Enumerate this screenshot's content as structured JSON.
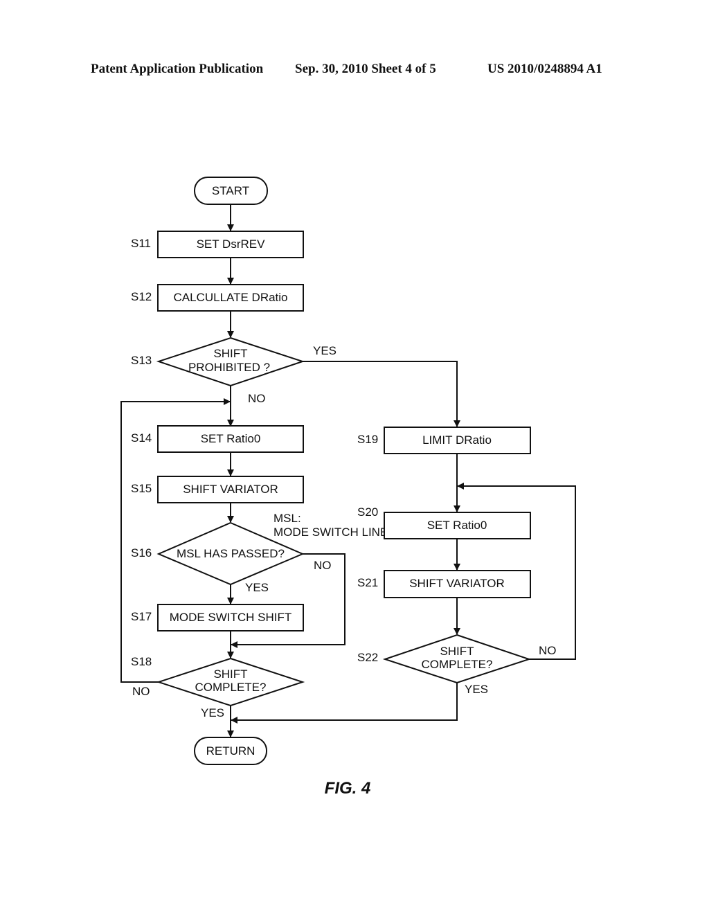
{
  "header": {
    "publication": "Patent Application Publication",
    "date_sheet": "Sep. 30, 2010   Sheet 4 of 5",
    "number": "US 2010/0248894 A1"
  },
  "flowchart": {
    "start": "START",
    "end": "RETURN",
    "steps": {
      "s11": {
        "id": "S11",
        "text": "SET DsrREV"
      },
      "s12": {
        "id": "S12",
        "text": "CALCULLATE DRatio"
      },
      "s13": {
        "id": "S13",
        "line1": "SHIFT",
        "line2": "PROHIBITED ?"
      },
      "s14": {
        "id": "S14",
        "text": "SET Ratio0"
      },
      "s15": {
        "id": "S15",
        "text": "SHIFT VARIATOR"
      },
      "s16": {
        "id": "S16",
        "text": "MSL HAS PASSED?"
      },
      "s17": {
        "id": "S17",
        "text": "MODE SWITCH SHIFT"
      },
      "s18": {
        "id": "S18",
        "line1": "SHIFT",
        "line2": "COMPLETE?"
      },
      "s19": {
        "id": "S19",
        "text": "LIMIT DRatio"
      },
      "s20": {
        "id": "S20",
        "text": "SET Ratio0"
      },
      "s21": {
        "id": "S21",
        "text": "SHIFT VARIATOR"
      },
      "s22": {
        "id": "S22",
        "line1": "SHIFT",
        "line2": "COMPLETE?"
      }
    },
    "branch_labels": {
      "s13_yes": "YES",
      "s13_no": "NO",
      "s16_yes": "YES",
      "s16_no": "NO",
      "s18_yes": "YES",
      "s18_no": "NO",
      "s22_yes": "YES",
      "s22_no": "NO"
    },
    "note": {
      "line1": "MSL:",
      "line2": "MODE SWITCH LINE"
    },
    "figure_label": "FIG. 4"
  }
}
